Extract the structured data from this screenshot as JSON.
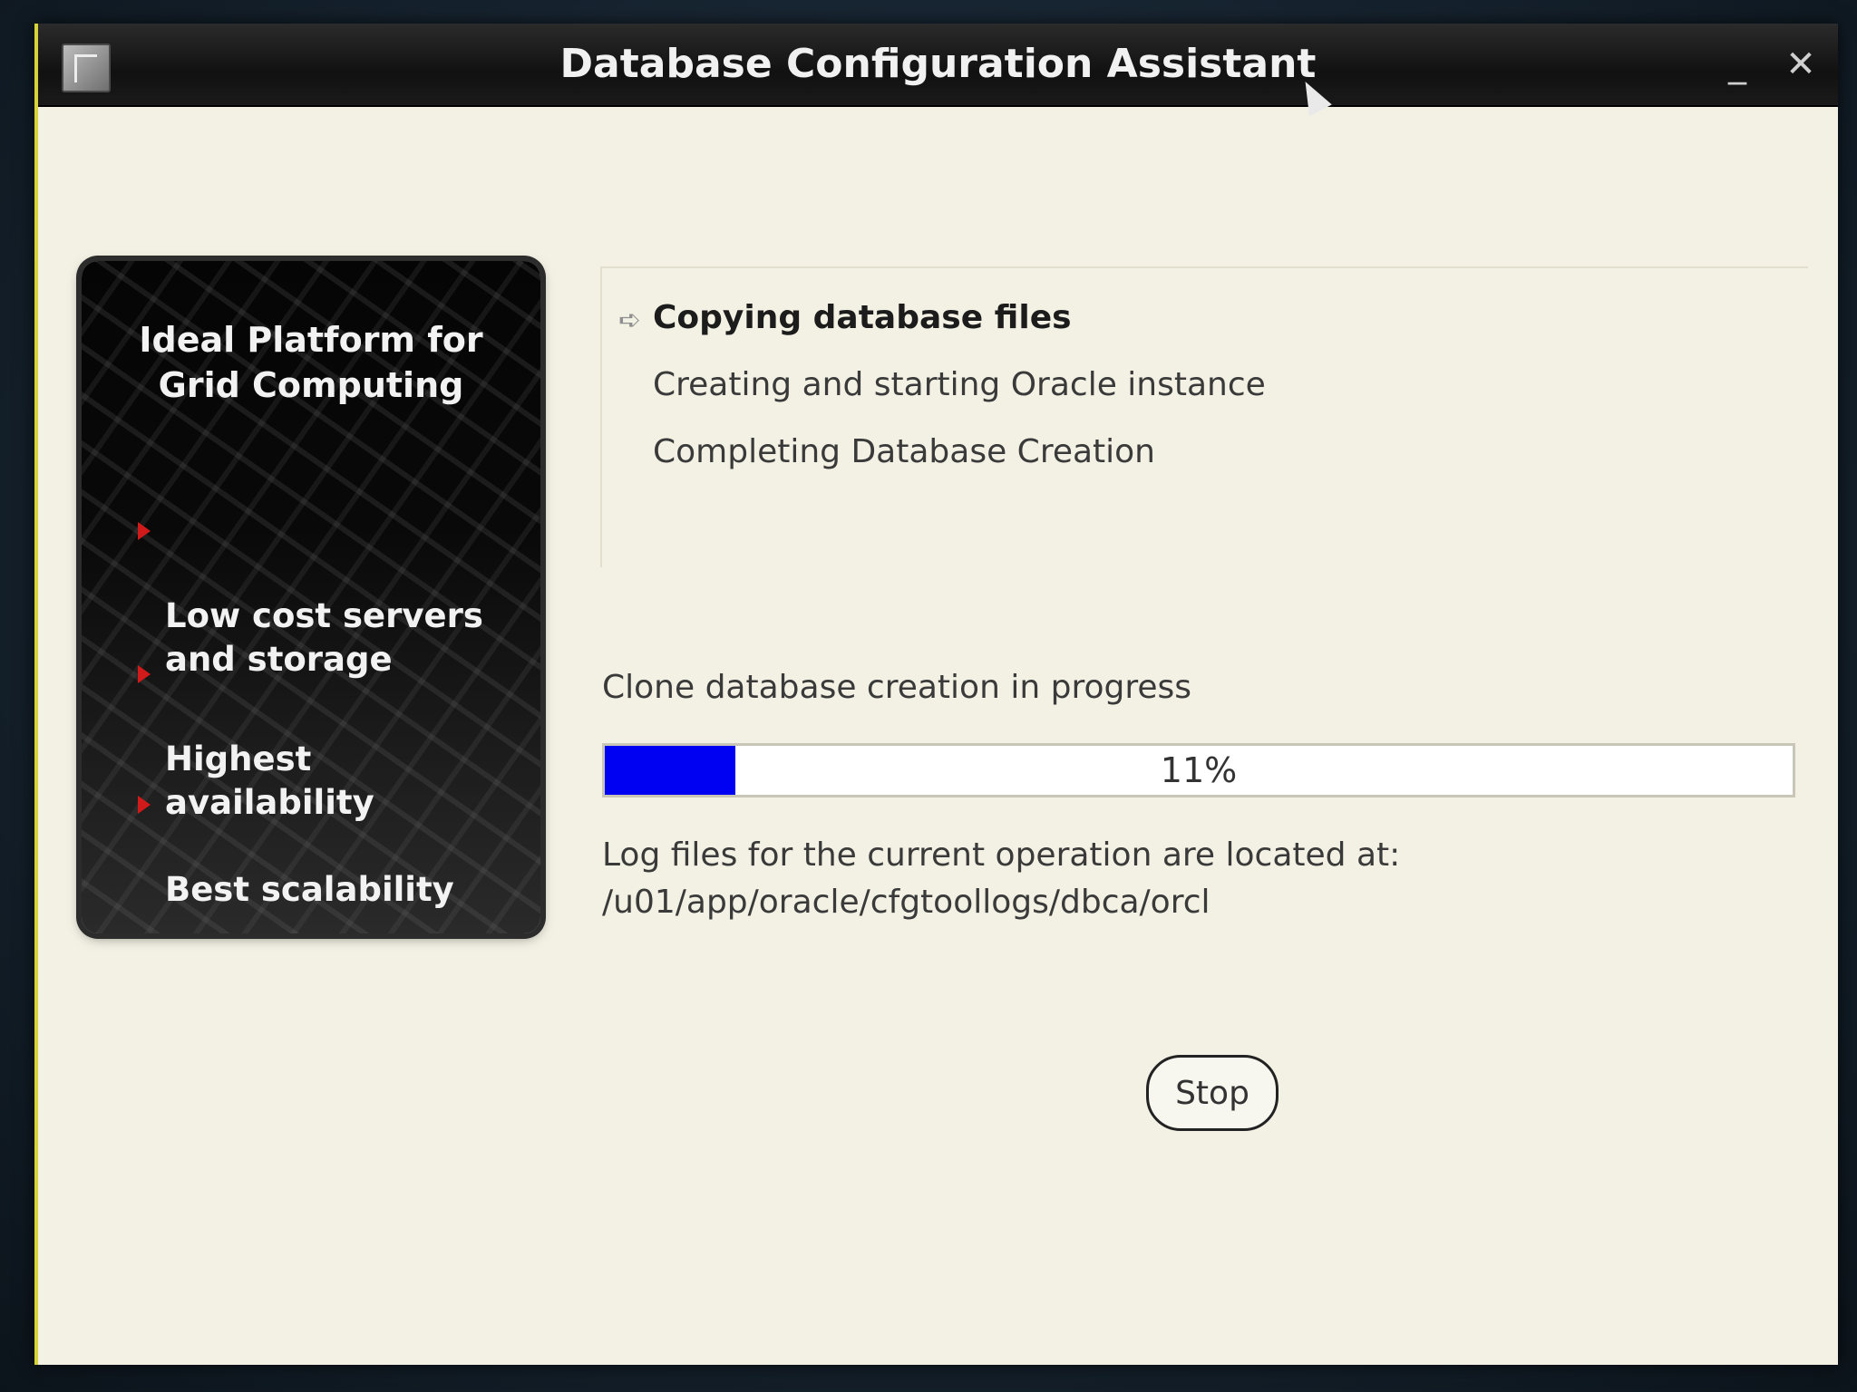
{
  "window": {
    "title": "Database Configuration Assistant",
    "minimize_glyph": "_",
    "close_glyph": "✕"
  },
  "promo": {
    "title": "Ideal Platform for\nGrid Computing",
    "items": [
      {
        "label": "Low cost servers\nand storage"
      },
      {
        "label": "Highest availability"
      },
      {
        "label": "Best scalability"
      }
    ]
  },
  "steps": [
    {
      "label": "Copying database files",
      "status": "current"
    },
    {
      "label": "Creating and starting Oracle instance",
      "status": "pending"
    },
    {
      "label": "Completing Database Creation",
      "status": "pending"
    }
  ],
  "progress": {
    "status_text": "Clone database creation in progress",
    "percent": 11,
    "label": "11%"
  },
  "log": {
    "line1": "Log files for the current operation are located at:",
    "line2": "/u01/app/oracle/cfgtoollogs/dbca/orcl"
  },
  "buttons": {
    "stop_label": "Stop"
  },
  "colors": {
    "progress_fill": "#0000f2",
    "bullet": "#d11a1a",
    "window_bg": "#f3f1e4"
  }
}
